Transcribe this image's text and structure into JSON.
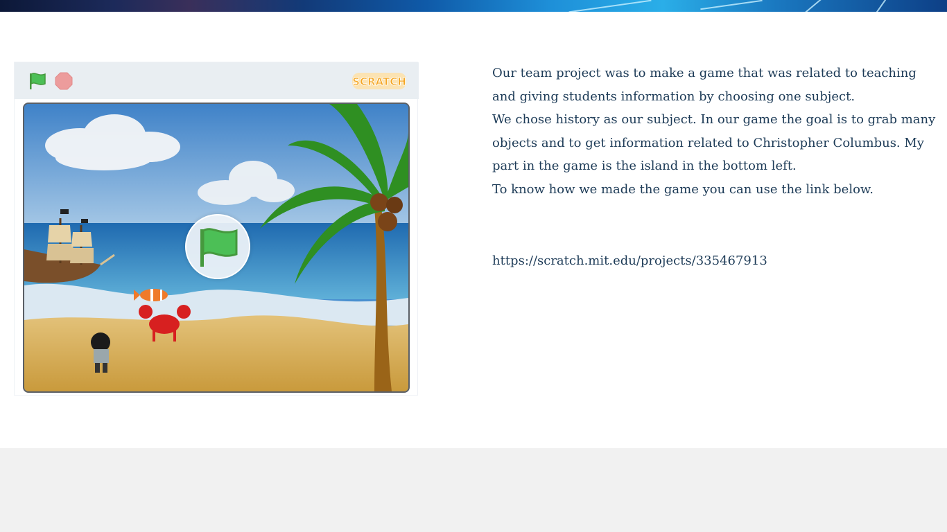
{
  "banner": {
    "icon": "decorative-banner"
  },
  "player": {
    "green_flag_icon": "green-flag-icon",
    "stop_icon": "stop-sign-icon",
    "logo_text": "SCRATCH",
    "stage_start_icon": "green-flag-icon"
  },
  "content": {
    "paragraphs": [
      "Our team project was to make a game that was related to teaching and giving students information by choosing one subject.",
      "We chose history as our subject. In our game the goal is to grab many objects and to get information related to Christopher Columbus. My part in the game is the island in the bottom left.",
      "To know how we made the game you can use the link below."
    ],
    "link": "https://scratch.mit.edu/projects/335467913"
  },
  "colors": {
    "text": "#1d3b57",
    "flag_green": "#4cbf56",
    "stop_red": "#ec9c9c",
    "footer": "#f1f1f1"
  }
}
